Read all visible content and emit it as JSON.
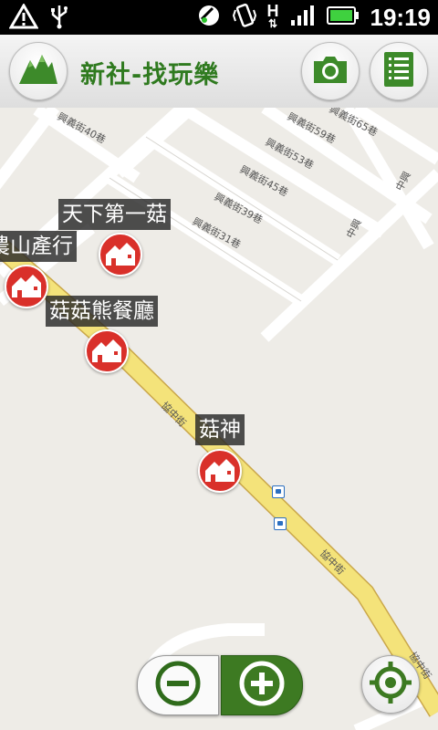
{
  "status_bar": {
    "time": "19:19",
    "network_type": "H",
    "icons": [
      "warning-icon",
      "usb-icon",
      "gps-icon",
      "vibrate-icon",
      "data-arrows-icon",
      "signal-icon",
      "battery-icon"
    ],
    "battery_color": "#3fd13f"
  },
  "header": {
    "app_title": "新社-找玩樂",
    "logo_icon": "mountain-logo-icon",
    "camera_icon": "camera-icon",
    "list_icon": "list-icon",
    "accent_color": "#2f7a1f"
  },
  "map": {
    "road_color": "#f4e37a",
    "streets": [
      "興義街40巷",
      "興義街59巷",
      "興義街53巷",
      "興義街45巷",
      "興義街39巷",
      "興義街31巷",
      "興義街65巷",
      "中興",
      "協中街",
      "協中街",
      "協中街",
      "中興"
    ],
    "pois": [
      {
        "name": "天下第一菇"
      },
      {
        "name": "農山產行"
      },
      {
        "name": "菇菇熊餐廳"
      },
      {
        "name": "菇神"
      }
    ],
    "marker_color": "#d9302a"
  },
  "controls": {
    "zoom_out_icon": "zoom-out-icon",
    "zoom_in_icon": "zoom-in-icon",
    "locate_icon": "my-location-icon"
  }
}
